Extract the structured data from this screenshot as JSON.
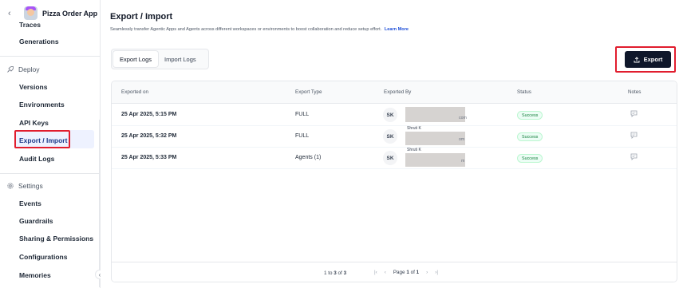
{
  "sidebar": {
    "app_name": "Pizza Order App",
    "items_top": [
      "Traces",
      "Generations"
    ],
    "deploy_label": "Deploy",
    "deploy_items": [
      "Versions",
      "Environments",
      "API Keys",
      "Export / Import",
      "Audit Logs"
    ],
    "settings_label": "Settings",
    "settings_items": [
      "Events",
      "Guardrails",
      "Sharing & Permissions",
      "Configurations",
      "Memories"
    ]
  },
  "main": {
    "title": "Export / Import",
    "subtitle": "Seamlessly transfer Agentic Apps and Agents across different workspaces or environments to boost collaboration and reduce setup effort.",
    "learn_more": "Learn More",
    "tabs": [
      "Export Logs",
      "Import Logs"
    ],
    "export_button": "Export"
  },
  "table": {
    "headers": [
      "Exported on",
      "Export Type",
      "Exported By",
      "Status",
      "Notes"
    ],
    "rows": [
      {
        "date": "25 Apr 2025, 5:15 PM",
        "type": "FULL",
        "initials": "SK",
        "name": "",
        "email_tail": "com",
        "status": "Success"
      },
      {
        "date": "25 Apr 2025, 5:32 PM",
        "type": "FULL",
        "initials": "SK",
        "name": "Shruti K",
        "email_tail": "om",
        "status": "Success"
      },
      {
        "date": "25 Apr 2025, 5:33 PM",
        "type": "Agents (1)",
        "initials": "SK",
        "name": "Shruti K",
        "email_tail": "m",
        "status": "Success"
      }
    ],
    "footer": {
      "range_from": "1",
      "range_to": "3",
      "range_total": "3",
      "range_to_word": "to",
      "range_of_word": "of",
      "page_word": "Page",
      "page_current": "1",
      "page_of_word": "of",
      "page_total": "1"
    }
  },
  "colors": {
    "accent": "#0f172a",
    "highlight": "#e11d2e",
    "success": "#15803d"
  },
  "icons": [
    "chevron-left-icon",
    "rocket-icon",
    "gear-icon",
    "upload-icon",
    "note-icon",
    "first-page-icon",
    "prev-page-icon",
    "next-page-icon",
    "last-page-icon",
    "collapse-chevron-icon"
  ]
}
